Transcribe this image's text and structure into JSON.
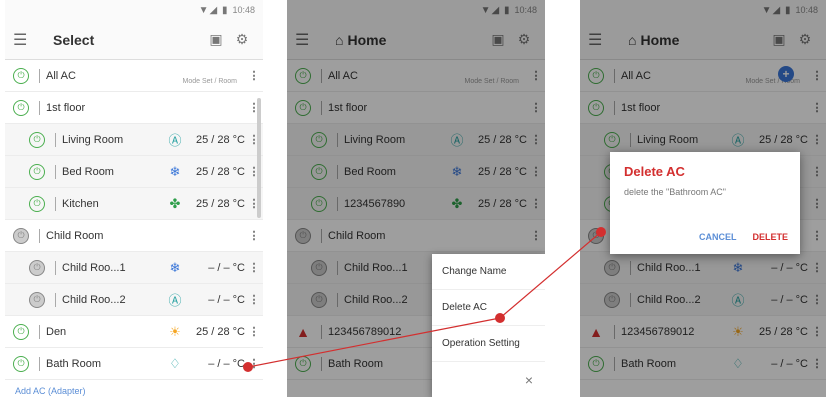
{
  "status": {
    "time": "10:48",
    "signal": "▼◢ ▮"
  },
  "screen1": {
    "title": "Select",
    "col_header": "Mode   Set / Room",
    "rows": [
      {
        "name": "All AC",
        "mode": "",
        "temp": "",
        "kind": "group"
      },
      {
        "name": "1st floor",
        "mode": "",
        "temp": "",
        "kind": "group"
      },
      {
        "name": "Living Room",
        "mode": "Ⓐ",
        "temp": "25 / 28 °C",
        "kind": "sub"
      },
      {
        "name": "Bed Room",
        "mode": "❄",
        "temp": "25 / 28 °C",
        "kind": "sub"
      },
      {
        "name": "Kitchen",
        "mode": "✤",
        "temp": "25 / 28 °C",
        "kind": "sub"
      },
      {
        "name": "Child Room",
        "mode": "",
        "temp": "",
        "kind": "group-off"
      },
      {
        "name": "Child Roo...1",
        "mode": "❄",
        "temp": "– / –  °C",
        "kind": "sub-off"
      },
      {
        "name": "Child Roo...2",
        "mode": "Ⓐ",
        "temp": "– / –  °C",
        "kind": "sub-off"
      },
      {
        "name": "Den",
        "mode": "☀",
        "temp": "25 / 28 °C",
        "kind": "group"
      },
      {
        "name": "Bath Room",
        "mode": "♢",
        "temp": "– / –  °C",
        "kind": "group"
      }
    ],
    "add_link": "Add AC (Adapter)"
  },
  "screen2": {
    "title": "Home",
    "col_header": "Mode   Set / Room",
    "rows": [
      {
        "name": "All AC",
        "mode": "",
        "temp": "",
        "kind": "group"
      },
      {
        "name": "1st floor",
        "mode": "",
        "temp": "",
        "kind": "group"
      },
      {
        "name": "Living Room",
        "mode": "Ⓐ",
        "temp": "25 / 28 °C",
        "kind": "sub"
      },
      {
        "name": "Bed Room",
        "mode": "❄",
        "temp": "25 / 28 °C",
        "kind": "sub"
      },
      {
        "name": "1234567890",
        "mode": "✤",
        "temp": "25 / 28 °C",
        "kind": "sub"
      },
      {
        "name": "Child Room",
        "mode": "",
        "temp": "",
        "kind": "group-off"
      },
      {
        "name": "Child Roo...1",
        "mode": "❄",
        "temp": "",
        "kind": "sub-off"
      },
      {
        "name": "Child Roo...2",
        "mode": "Ⓐ",
        "temp": "",
        "kind": "sub-off"
      },
      {
        "name": "123456789012",
        "mode": "",
        "temp": "",
        "kind": "warn"
      },
      {
        "name": "Bath Room",
        "mode": "",
        "temp": "",
        "kind": "group"
      }
    ],
    "menu": {
      "change_name": "Change Name",
      "delete_ac": "Delete AC",
      "operation_setting": "Operation Setting",
      "close": "×"
    }
  },
  "screen3": {
    "title": "Home",
    "col_header": "Mode   Set / Room",
    "rows": [
      {
        "name": "All AC",
        "mode": "",
        "temp": "",
        "kind": "group"
      },
      {
        "name": "1st floor",
        "mode": "",
        "temp": "",
        "kind": "group"
      },
      {
        "name": "Living Room",
        "mode": "Ⓐ",
        "temp": "25 / 28 °C",
        "kind": "sub"
      },
      {
        "name": "",
        "mode": "",
        "temp": "",
        "kind": "sub"
      },
      {
        "name": "",
        "mode": "",
        "temp": "",
        "kind": "sub"
      },
      {
        "name": "",
        "mode": "",
        "temp": "",
        "kind": "group-off"
      },
      {
        "name": "Child Roo...1",
        "mode": "❄",
        "temp": "– / –  °C",
        "kind": "sub-off"
      },
      {
        "name": "Child Roo...2",
        "mode": "Ⓐ",
        "temp": "– / –  °C",
        "kind": "sub-off"
      },
      {
        "name": "123456789012",
        "mode": "☀",
        "temp": "25 / 28 °C",
        "kind": "warn"
      },
      {
        "name": "Bath Room",
        "mode": "♢",
        "temp": "– / –  °C",
        "kind": "group"
      }
    ],
    "dialog": {
      "title": "Delete AC",
      "message": "delete the \"Bathroom AC\"",
      "cancel": "CANCEL",
      "delete": "DELETE"
    }
  },
  "colors": {
    "accent": "#d32f2f",
    "link": "#5b8ed6",
    "power_on": "#4caf50"
  }
}
